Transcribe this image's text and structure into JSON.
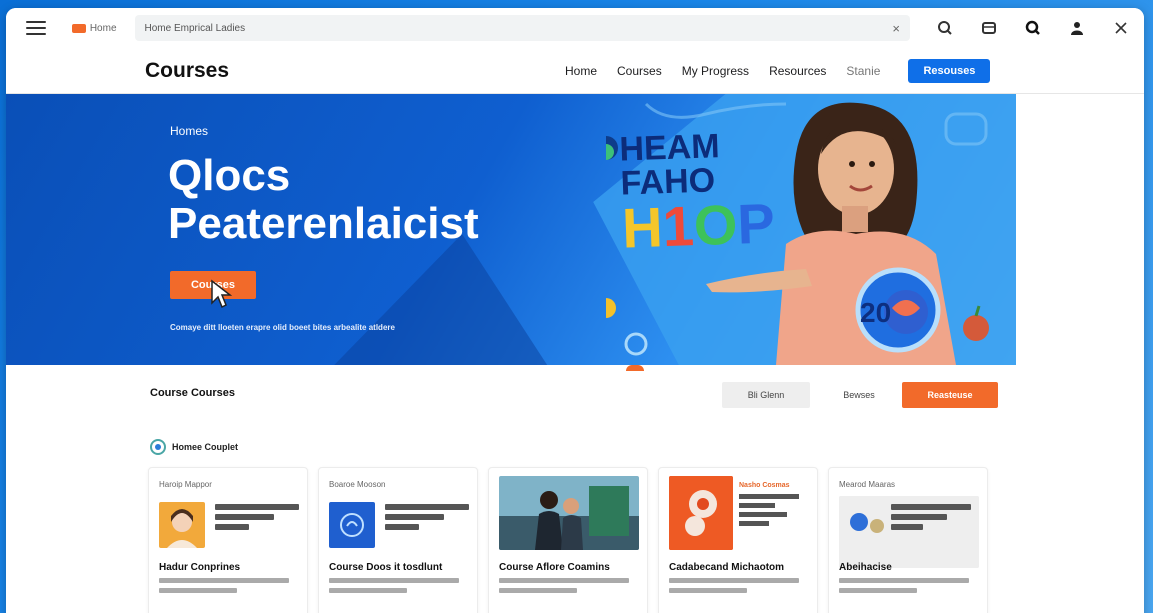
{
  "browser": {
    "tab_label": "Home",
    "address_text": "Home Emprical Ladies",
    "close_symbol": "×"
  },
  "site": {
    "title": "Courses",
    "nav": [
      "Home",
      "Courses",
      "My Progress",
      "Resources",
      "Stanie"
    ],
    "cta": "Resouses"
  },
  "hero": {
    "breadcrumb": "Homes",
    "title_line1": "Qlocs",
    "title_line2": "Peaterenlaicist",
    "button": "Courses",
    "tagline": "Comaye ditt lloeten erapre olid boeet bites arbealite atldere",
    "art_line1": "HEAM",
    "art_line2": "FAHO",
    "art_line3": [
      "H",
      "1",
      "O",
      "P"
    ],
    "badge_text": "20"
  },
  "content": {
    "section_title": "Course Courses",
    "segments": [
      "Bli Glenn",
      "Bewses",
      "Reasteuse"
    ],
    "subheading": "Homee Couplet",
    "cards": [
      {
        "top": "Haroip Mappor",
        "title": "Hadur Conprines"
      },
      {
        "top": "Boaroe Mooson",
        "title": "Course Doos it tosdlunt"
      },
      {
        "top": "",
        "title": "Course Aflore Coamins"
      },
      {
        "top": "Nasho Cosmas",
        "title": "Cadabecand Michaotom"
      },
      {
        "top": "Mearod Maaras",
        "title": "Abeihacise"
      }
    ]
  },
  "colors": {
    "accent_blue": "#0f6fe8",
    "accent_orange": "#f26a2a",
    "hero_blue": "#0a4fb7"
  }
}
